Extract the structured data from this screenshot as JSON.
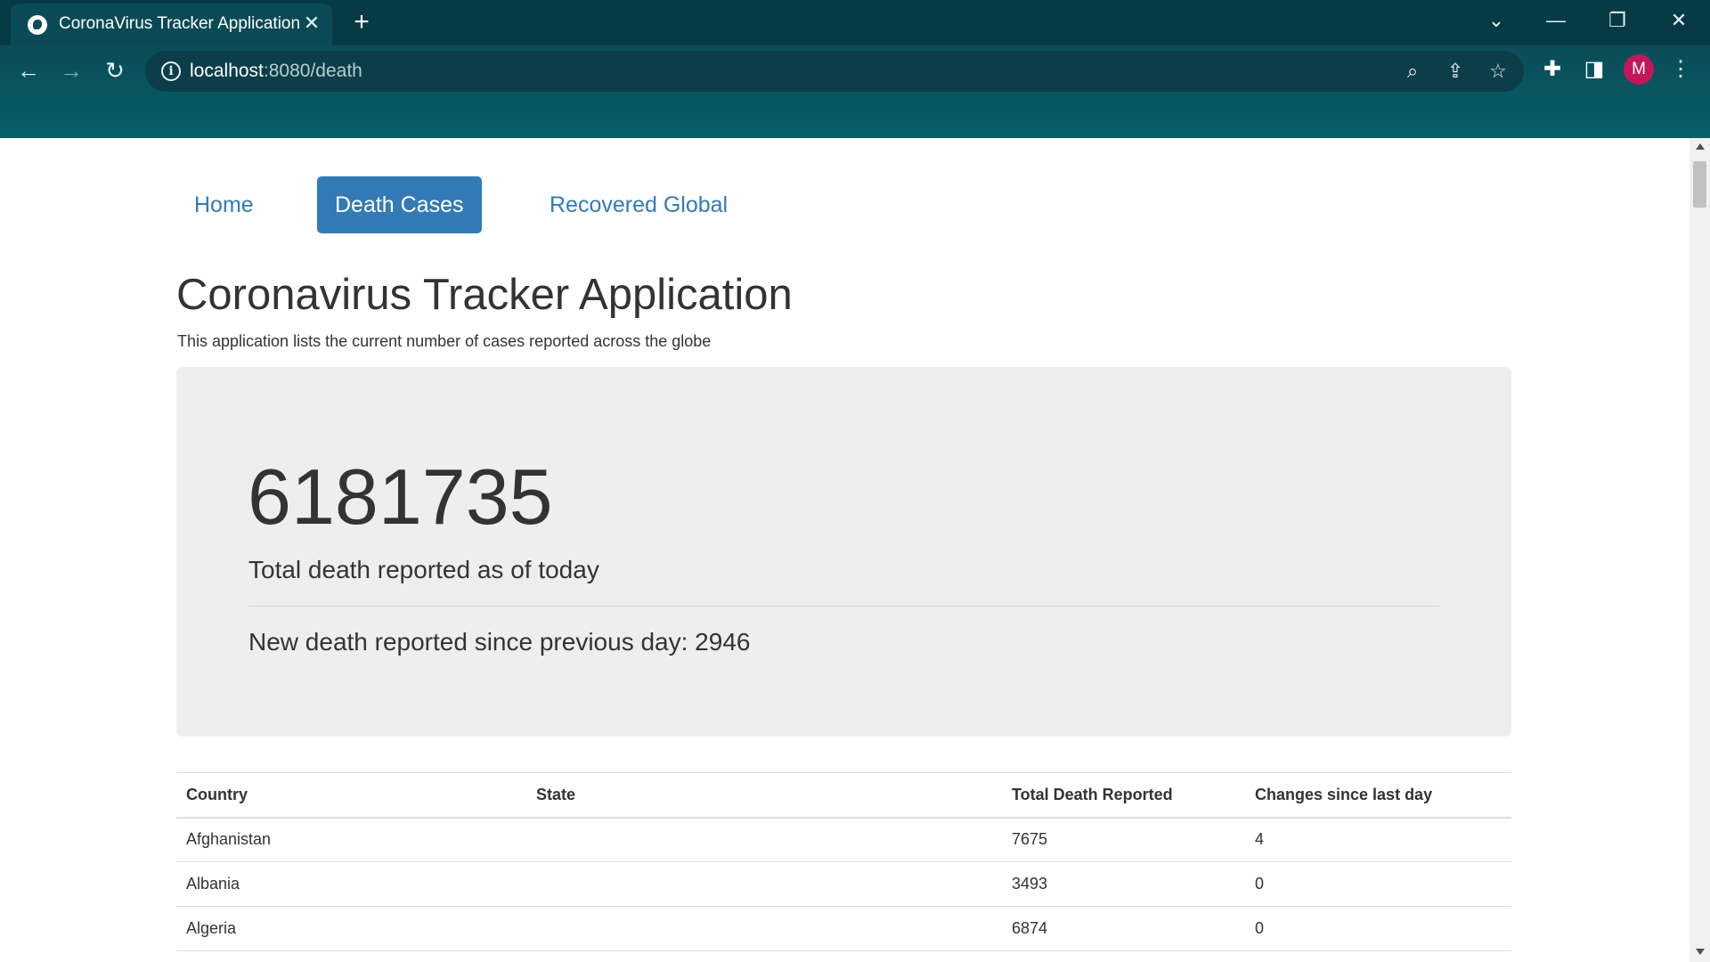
{
  "browser": {
    "tab_title": "CoronaVirus Tracker Application",
    "tab_favicon": "globe-icon",
    "url_host": "localhost",
    "url_rest": ":8080/death",
    "profile_initial": "M",
    "profile_color": "#c2185b"
  },
  "nav": {
    "items": [
      {
        "label": "Home",
        "active": false
      },
      {
        "label": "Death Cases",
        "active": true
      },
      {
        "label": "Recovered Global",
        "active": false
      }
    ]
  },
  "page": {
    "title": "Coronavirus Tracker Application",
    "lead": "This application lists the current number of cases reported across the globe"
  },
  "summary": {
    "total_deaths": "6181735",
    "total_label": "Total death reported as of today",
    "new_deaths_text": "New death reported since previous day: 2946"
  },
  "table": {
    "headers": [
      "Country",
      "State",
      "Total Death Reported",
      "Changes since last day"
    ],
    "rows": [
      [
        "Afghanistan",
        "",
        "7675",
        "4"
      ],
      [
        "Albania",
        "",
        "3493",
        "0"
      ],
      [
        "Algeria",
        "",
        "6874",
        "0"
      ]
    ]
  },
  "colors": {
    "accent": "#337ab7",
    "jumbotron_bg": "#eeeeee",
    "browser_frame": "#063a45"
  }
}
